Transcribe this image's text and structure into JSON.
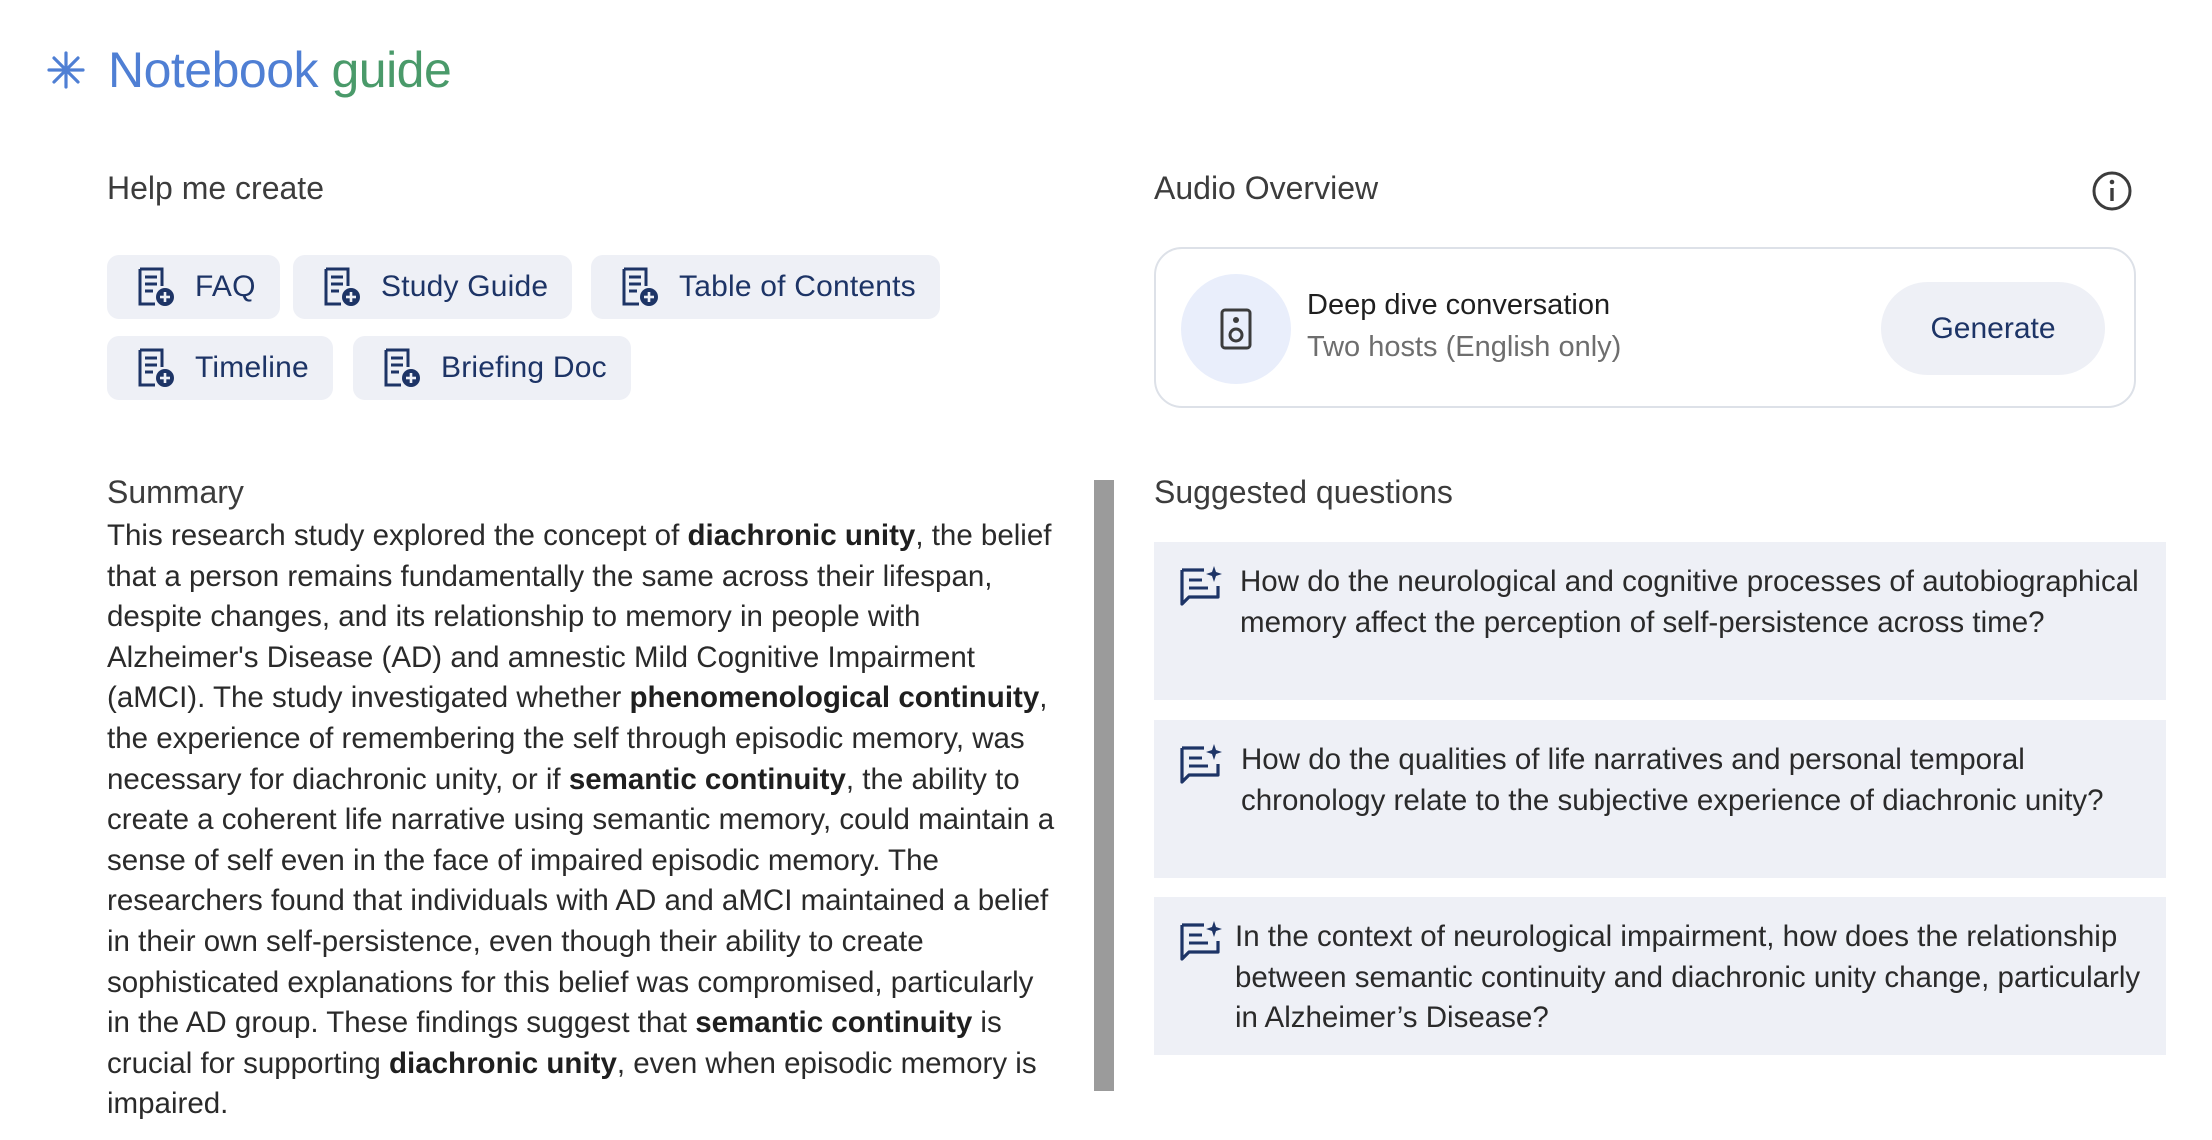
{
  "header": {
    "title_part1": "Notebook",
    "title_part2": "guide"
  },
  "help_create": {
    "heading": "Help me create",
    "chips": [
      "FAQ",
      "Study Guide",
      "Table of Contents",
      "Timeline",
      "Briefing Doc"
    ]
  },
  "audio_overview": {
    "heading": "Audio Overview",
    "card_title": "Deep dive conversation",
    "card_subtitle": "Two hosts (English only)",
    "generate_label": "Generate"
  },
  "summary": {
    "heading": "Summary",
    "segments": [
      {
        "text": "This research study explored the concept of ",
        "bold": false
      },
      {
        "text": "diachronic unity",
        "bold": true
      },
      {
        "text": ", the belief that a person remains fundamentally the same across their lifespan, despite changes, and its relationship to memory in people with Alzheimer's Disease (AD) and amnestic Mild Cognitive Impairment (aMCI). The study investigated whether ",
        "bold": false
      },
      {
        "text": "phenomenological continuity",
        "bold": true
      },
      {
        "text": ", the experience of remembering the self through episodic memory, was necessary for diachronic unity, or if ",
        "bold": false
      },
      {
        "text": "semantic continuity",
        "bold": true
      },
      {
        "text": ", the ability to create a coherent life narrative using semantic memory, could maintain a sense of self even in the face of impaired episodic memory. The researchers found that individuals with AD and aMCI maintained a belief in their own self-persistence, even though their ability to create sophisticated explanations for this belief was compromised, particularly in the AD group. These findings suggest that ",
        "bold": false
      },
      {
        "text": "semantic continuity",
        "bold": true
      },
      {
        "text": " is crucial for supporting ",
        "bold": false
      },
      {
        "text": "diachronic unity",
        "bold": true
      },
      {
        "text": ", even when episodic memory is impaired.",
        "bold": false
      }
    ]
  },
  "suggested": {
    "heading": "Suggested questions",
    "questions": [
      "How do the neurological and cognitive processes of autobiographical memory affect the perception of self-persistence across time?",
      "How do the qualities of life narratives and personal temporal chronology relate to the subjective experience of diachronic unity?",
      "In the context of neurological impairment, how does the relationship between semantic continuity and diachronic unity change, particularly in Alzheimer’s Disease?"
    ]
  },
  "colors": {
    "title_blue": "#4f7fd4",
    "title_green": "#4a9a6a",
    "chip_bg": "#eef0f6",
    "chip_text": "#1d3466",
    "scrollbar": "#9b9b9b"
  },
  "icons": {
    "header": "sparkle-icon",
    "chips": "add-note-icon",
    "info": "info-icon",
    "audio": "speaker-icon",
    "question": "suggest-chat-icon"
  }
}
